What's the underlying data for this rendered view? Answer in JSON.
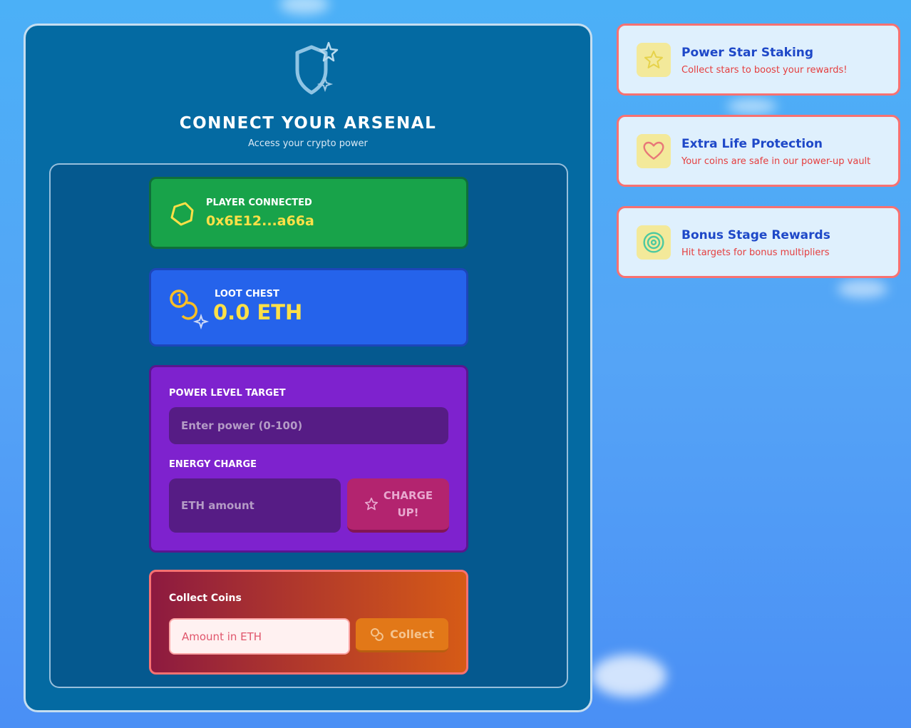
{
  "header": {
    "title": "CONNECT YOUR ARSENAL",
    "subtitle": "Access your crypto power"
  },
  "wallet": {
    "label": "PLAYER CONNECTED",
    "address": "0x6E12...a66a"
  },
  "balance": {
    "label": "LOOT CHEST",
    "value": "0.0 ETH"
  },
  "power_form": {
    "power_label": "POWER LEVEL TARGET",
    "power_placeholder": "Enter power (0-100)",
    "energy_label": "ENERGY CHARGE",
    "eth_placeholder": "ETH amount",
    "charge_button": "CHARGE UP!"
  },
  "collect_form": {
    "label": "Collect Coins",
    "amount_placeholder": "Amount in ETH",
    "collect_button": "Collect"
  },
  "features": [
    {
      "title": "Power Star Staking",
      "desc": "Collect stars to boost your rewards!",
      "icon": "star-icon"
    },
    {
      "title": "Extra Life Protection",
      "desc": "Your coins are safe in our power-up vault",
      "icon": "heart-icon"
    },
    {
      "title": "Bonus Stage Rewards",
      "desc": "Hit targets for bonus multipliers",
      "icon": "target-icon"
    }
  ],
  "colors": {
    "accent_yellow": "#fde047",
    "card_bg": "#046aa2",
    "feature_title": "#1e48c8",
    "feature_desc": "#e53e3e"
  }
}
